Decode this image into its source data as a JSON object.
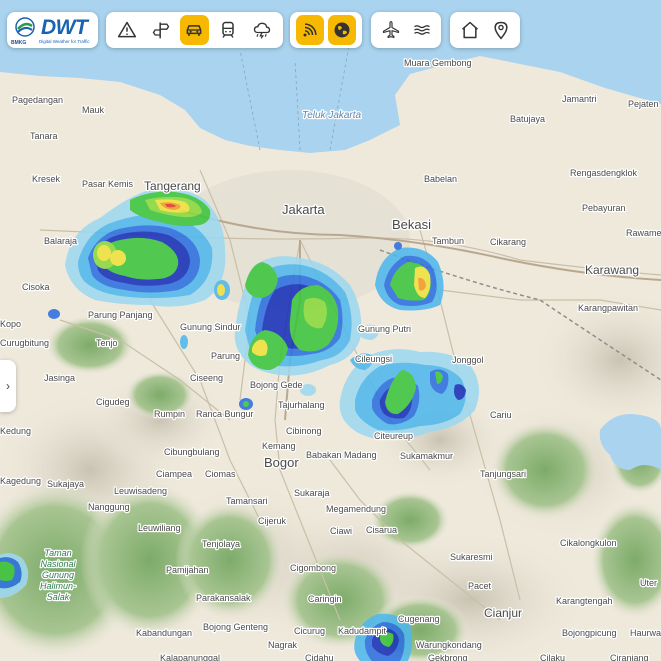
{
  "brand": {
    "org": "BMKG",
    "title": "DWT",
    "subtitle": "Digital Weather for Traffic"
  },
  "toolbar": {
    "groups": [
      {
        "buttons": [
          {
            "icon": "warning-icon",
            "active": false
          },
          {
            "icon": "signpost-icon",
            "active": false
          },
          {
            "icon": "car-icon",
            "active": true
          },
          {
            "icon": "train-icon",
            "active": false
          },
          {
            "icon": "storm-cloud-icon",
            "active": false
          }
        ]
      },
      {
        "buttons": [
          {
            "icon": "radar-icon",
            "active": true
          },
          {
            "icon": "satellite-icon",
            "active": true
          }
        ]
      },
      {
        "buttons": [
          {
            "icon": "airplane-icon",
            "active": false
          },
          {
            "icon": "waves-icon",
            "active": false
          }
        ]
      },
      {
        "buttons": [
          {
            "icon": "home-icon",
            "active": false
          },
          {
            "icon": "location-pin-icon",
            "active": false
          }
        ]
      }
    ],
    "active_color": "#f6b800"
  },
  "map": {
    "sea_color": "#a9d3ee",
    "water_labels": [
      "Teluk Jakarta"
    ],
    "park_label": "Taman Nasional Gunung Halimun-Salak",
    "labels": {
      "major": [
        "Jakarta",
        "Bekasi",
        "Karawang",
        "Bogor",
        "Cianjur",
        "Tangerang"
      ],
      "towns": [
        "Muara Gembong",
        "Pagedangan",
        "Mauk",
        "Jamantri",
        "Pejaten",
        "Batujaya",
        "Tanara",
        "Kresek",
        "Pasar Kemis",
        "Babelan",
        "Rengasdengklok",
        "Pebayuran",
        "Rawamerta",
        "Tambun",
        "Cikarang",
        "Balaraja",
        "Cisoka",
        "Karangpawitan",
        "Kopo",
        "Parung Panjang",
        "Gunung Sindur",
        "Gunung Putri",
        "Parung",
        "Tenjo",
        "Curugbitung",
        "Jasinga",
        "Ciseeng",
        "Bojong Gede",
        "Cileungsi",
        "Jonggol",
        "Cigudeg",
        "Rumpin",
        "Ranca Bungur",
        "Tajurhalang",
        "Cariu",
        "Cibinong",
        "Kemang",
        "Babakan Madang",
        "Citeureup",
        "Sukamakmur",
        "Cibungbulang",
        "Ciampea",
        "Ciomas",
        "Tanjungsari",
        "Sukajaya",
        "Leuwisadeng",
        "Nanggung",
        "Tamansari",
        "Sukaraja",
        "Megamendung",
        "Leuwiliang",
        "Cijeruk",
        "Ciawi",
        "Cisarua",
        "Tenjolaya",
        "Cikalongkulon",
        "Pamijahan",
        "Cigombong",
        "Sukaresmi",
        "Parakansalak",
        "Caringin",
        "Pacet",
        "Bojong Genteng",
        "Cicurug",
        "Cugenang",
        "Karangtengah",
        "Kabandungan",
        "Nagrak",
        "Kadudampit",
        "Warungkondang",
        "Bojongpicung",
        "Haurwangi",
        "Kalapanunggal",
        "Cidahu",
        "Gekbrong",
        "Cilaku",
        "Ciranjang",
        "Kedung",
        "Kagedung",
        "Uter"
      ]
    }
  },
  "radar": {
    "legend_colors": [
      "#9ed8f0",
      "#4fb8ec",
      "#2b6fe0",
      "#1730b8",
      "#3cc43c",
      "#8ad83c",
      "#f0e23c",
      "#f29a2a",
      "#e03a2a"
    ]
  }
}
